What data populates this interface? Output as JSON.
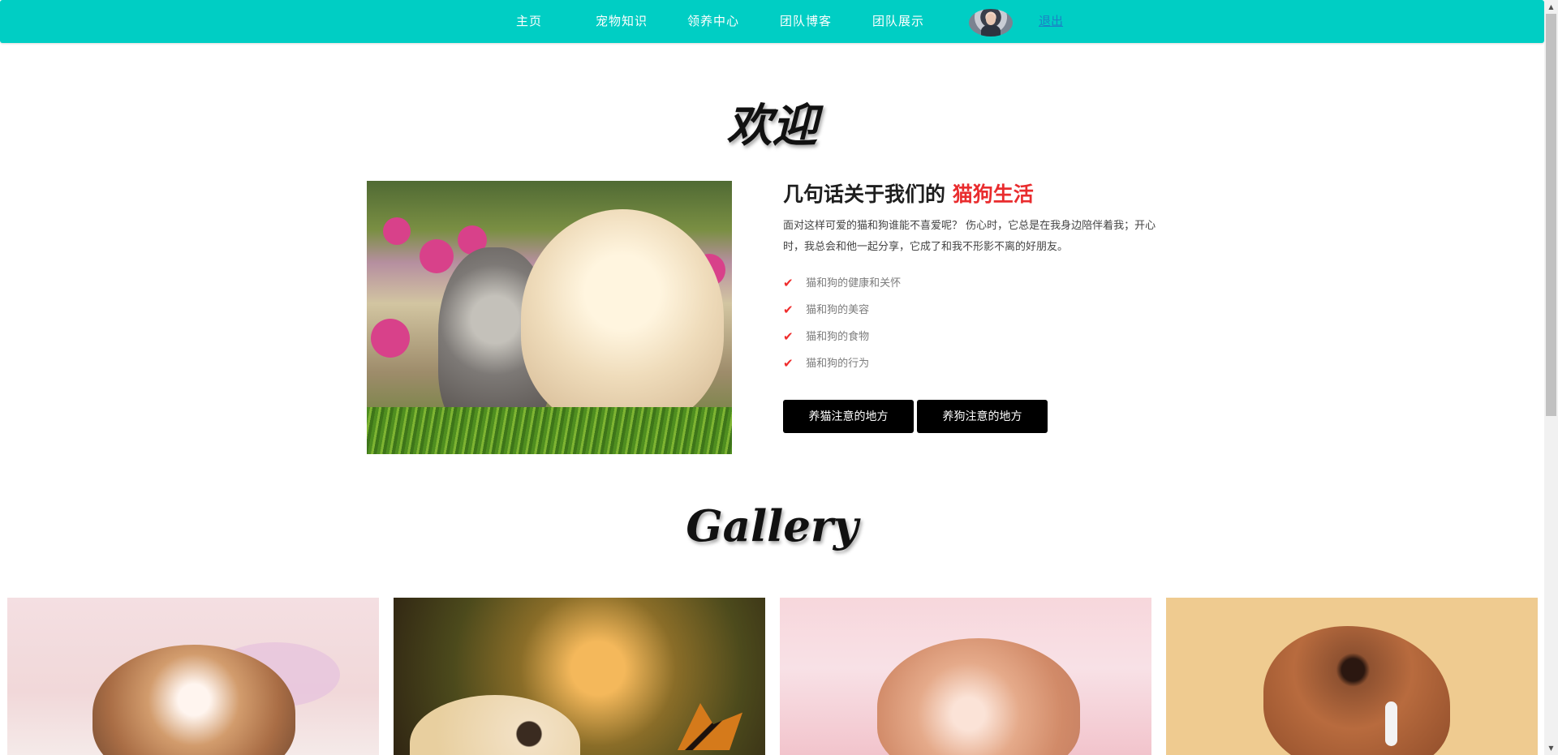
{
  "navbar": {
    "items": [
      {
        "label": "主页"
      },
      {
        "label": "宠物知识"
      },
      {
        "label": "领养中心"
      },
      {
        "label": "团队博客"
      },
      {
        "label": "团队展示"
      }
    ],
    "logout_label": "退出",
    "avatar_icon": "user-avatar-icon",
    "background_color": "#00cec4"
  },
  "welcome": {
    "title": "欢迎",
    "heading_prefix": "几句话关于我们的 ",
    "heading_highlight": "猫狗生活",
    "paragraph": "面对这样可爱的猫和狗谁能不喜爱呢？ 伤心时，它总是在我身边陪伴着我；开心时，我总会和他一起分享，它成了和我不形影不离的好朋友。",
    "features": [
      {
        "label": "猫和狗的健康和关怀"
      },
      {
        "label": "猫和狗的美容"
      },
      {
        "label": "猫和狗的食物"
      },
      {
        "label": "猫和狗的行为"
      }
    ],
    "buttons": {
      "cat": "养猫注意的地方",
      "dog": "养狗注意的地方"
    },
    "highlight_color": "#e92c2e"
  },
  "gallery": {
    "title": "Gallery"
  }
}
